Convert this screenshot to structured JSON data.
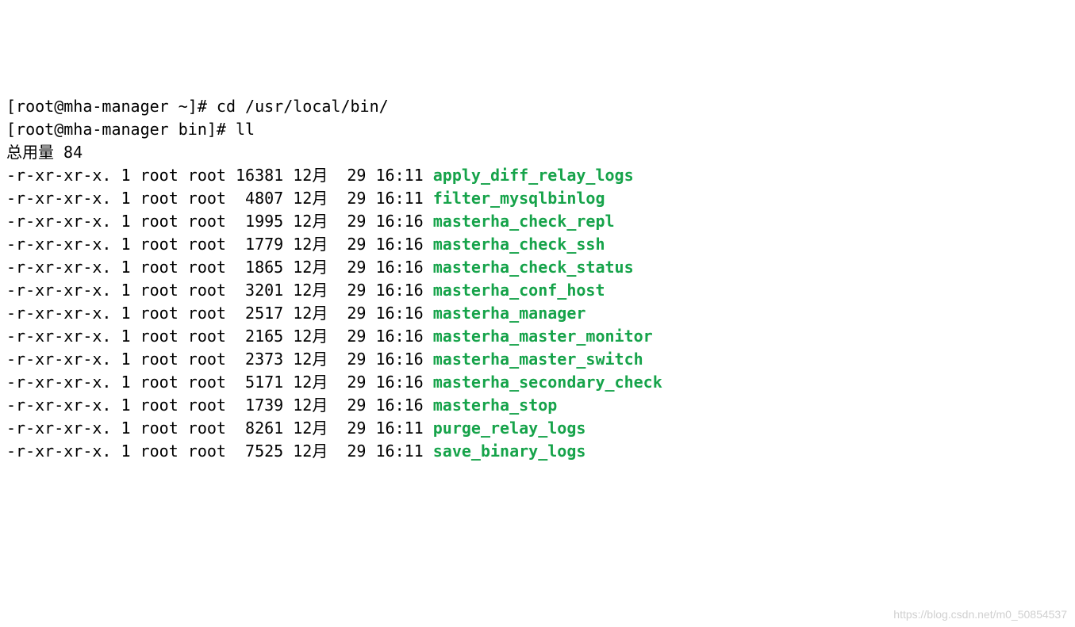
{
  "prompt1": "[root@mha-manager ~]# ",
  "cmd1": "cd /usr/local/bin/",
  "prompt2": "[root@mha-manager bin]# ",
  "cmd2": "ll",
  "total_label": "总用量 84",
  "listing": [
    {
      "perm": "-r-xr-xr-x.",
      "links": "1",
      "owner": "root",
      "group": "root",
      "size": "16381",
      "month": "12月",
      "day": "29",
      "time": "16:11",
      "name": "apply_diff_relay_logs"
    },
    {
      "perm": "-r-xr-xr-x.",
      "links": "1",
      "owner": "root",
      "group": "root",
      "size": "4807",
      "month": "12月",
      "day": "29",
      "time": "16:11",
      "name": "filter_mysqlbinlog"
    },
    {
      "perm": "-r-xr-xr-x.",
      "links": "1",
      "owner": "root",
      "group": "root",
      "size": "1995",
      "month": "12月",
      "day": "29",
      "time": "16:16",
      "name": "masterha_check_repl"
    },
    {
      "perm": "-r-xr-xr-x.",
      "links": "1",
      "owner": "root",
      "group": "root",
      "size": "1779",
      "month": "12月",
      "day": "29",
      "time": "16:16",
      "name": "masterha_check_ssh"
    },
    {
      "perm": "-r-xr-xr-x.",
      "links": "1",
      "owner": "root",
      "group": "root",
      "size": "1865",
      "month": "12月",
      "day": "29",
      "time": "16:16",
      "name": "masterha_check_status"
    },
    {
      "perm": "-r-xr-xr-x.",
      "links": "1",
      "owner": "root",
      "group": "root",
      "size": "3201",
      "month": "12月",
      "day": "29",
      "time": "16:16",
      "name": "masterha_conf_host"
    },
    {
      "perm": "-r-xr-xr-x.",
      "links": "1",
      "owner": "root",
      "group": "root",
      "size": "2517",
      "month": "12月",
      "day": "29",
      "time": "16:16",
      "name": "masterha_manager"
    },
    {
      "perm": "-r-xr-xr-x.",
      "links": "1",
      "owner": "root",
      "group": "root",
      "size": "2165",
      "month": "12月",
      "day": "29",
      "time": "16:16",
      "name": "masterha_master_monitor"
    },
    {
      "perm": "-r-xr-xr-x.",
      "links": "1",
      "owner": "root",
      "group": "root",
      "size": "2373",
      "month": "12月",
      "day": "29",
      "time": "16:16",
      "name": "masterha_master_switch"
    },
    {
      "perm": "-r-xr-xr-x.",
      "links": "1",
      "owner": "root",
      "group": "root",
      "size": "5171",
      "month": "12月",
      "day": "29",
      "time": "16:16",
      "name": "masterha_secondary_check"
    },
    {
      "perm": "-r-xr-xr-x.",
      "links": "1",
      "owner": "root",
      "group": "root",
      "size": "1739",
      "month": "12月",
      "day": "29",
      "time": "16:16",
      "name": "masterha_stop"
    },
    {
      "perm": "-r-xr-xr-x.",
      "links": "1",
      "owner": "root",
      "group": "root",
      "size": "8261",
      "month": "12月",
      "day": "29",
      "time": "16:11",
      "name": "purge_relay_logs"
    },
    {
      "perm": "-r-xr-xr-x.",
      "links": "1",
      "owner": "root",
      "group": "root",
      "size": "7525",
      "month": "12月",
      "day": "29",
      "time": "16:11",
      "name": "save_binary_logs"
    }
  ],
  "watermark": "https://blog.csdn.net/m0_50854537"
}
